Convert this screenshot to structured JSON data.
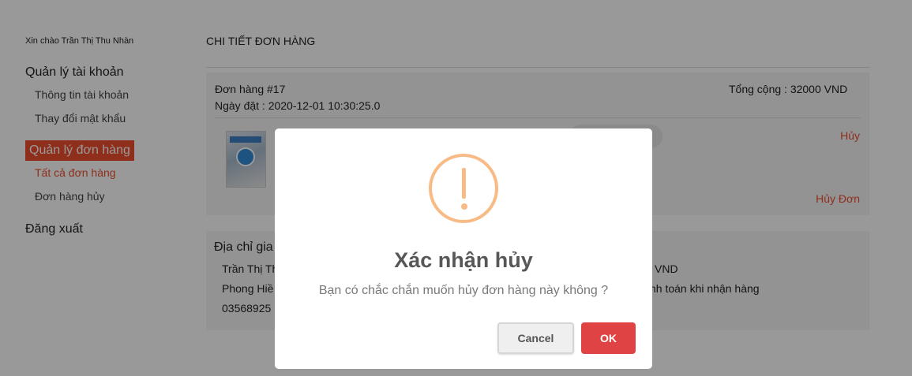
{
  "sidebar": {
    "greeting": "Xin chào Trần Thị Thu Nhàn",
    "account_section": "Quản lý tài khoản",
    "account_info": "Thông tin tài khoản",
    "change_password": "Thay đổi mật khẩu",
    "orders_section": "Quản lý đơn hàng",
    "all_orders": "Tất cả đơn hàng",
    "cancelled_orders": "Đơn hàng hủy",
    "logout": "Đăng xuất"
  },
  "main": {
    "title": "CHI TIẾT ĐƠN HÀNG",
    "order": {
      "id": "Đơn hàng #17",
      "date": "Ngày đặt : 2020-12-01 10:30:25.0",
      "total": "Tổng cộng : 32000 VND",
      "item_cancel": "Hủy",
      "cancel_order": "Hủy Đơn",
      "thumbnail_icon": "book-cover-image"
    },
    "address": {
      "title": "Địa chỉ gia",
      "name": "Trần Thị Th",
      "address_line": "Phong Hiề",
      "phone": "03568925",
      "right_amount": "VND",
      "right_payment": "nh toán khi nhận hàng"
    }
  },
  "dialog": {
    "icon": "warning-icon",
    "title": "Xác nhận hủy",
    "message": "Bạn có chắc chắn muốn hủy đơn hàng này không ?",
    "cancel_label": "Cancel",
    "ok_label": "OK",
    "colors": {
      "warning": "#f8bb86",
      "ok_button": "#e04343",
      "accent": "#ee4d2d"
    }
  }
}
